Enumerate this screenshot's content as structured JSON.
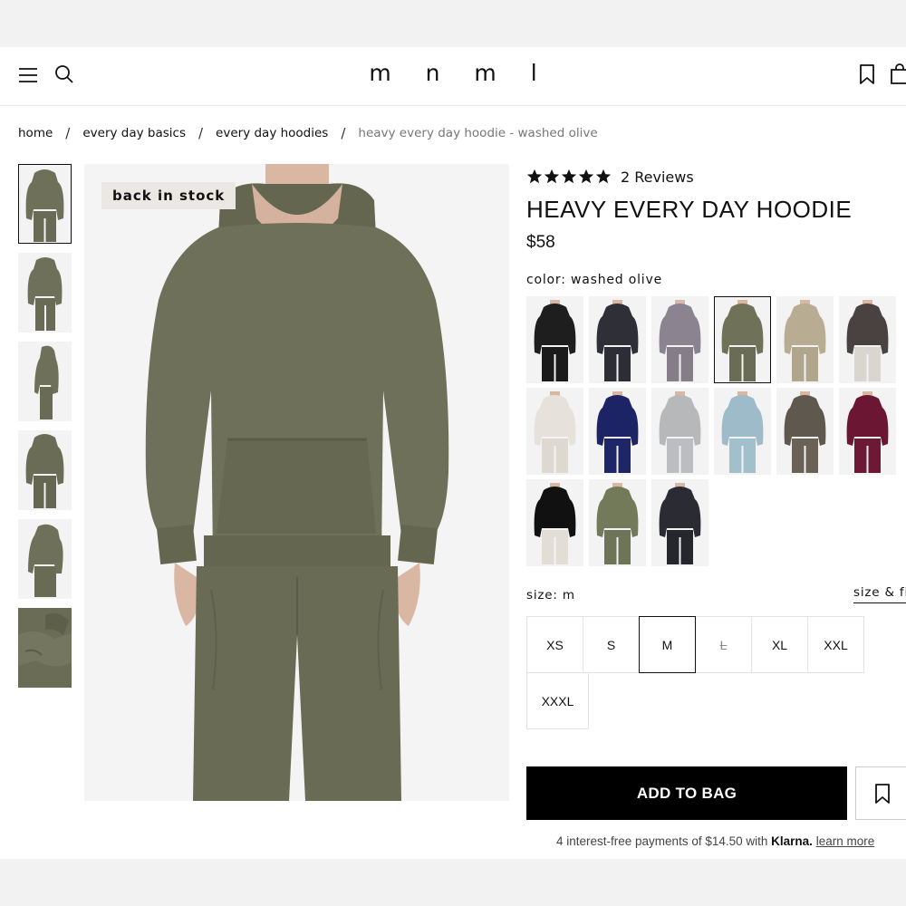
{
  "header": {
    "logo": "m n m l",
    "icons": [
      "menu-icon",
      "search-icon",
      "bookmark-icon",
      "bag-icon"
    ]
  },
  "breadcrumb": {
    "items": [
      "home",
      "every day basics",
      "every day hoodies"
    ],
    "separator": "/",
    "current": "heavy every day hoodie - washed olive"
  },
  "gallery": {
    "badge": "back in stock",
    "thumb_count": 6,
    "active_thumb": 0
  },
  "product": {
    "rating_stars": 5,
    "reviews": "2 Reviews",
    "title": "HEAVY EVERY DAY HOODIE",
    "price": "$58",
    "color_label": "color: washed olive",
    "colors": [
      {
        "hoodie": "#1e1e1f",
        "pant": "#1b1b1c"
      },
      {
        "hoodie": "#2f2f38",
        "pant": "#2d2d35"
      },
      {
        "hoodie": "#8b8490",
        "pant": "#857e88"
      },
      {
        "hoodie": "#6f7158",
        "pant": "#6a6c55"
      },
      {
        "hoodie": "#b8ad93",
        "pant": "#b0a68e"
      },
      {
        "hoodie": "#4a4240",
        "pant": "#d9d6d0"
      },
      {
        "hoodie": "#e6e2db",
        "pant": "#ddd8d0"
      },
      {
        "hoodie": "#1d2466",
        "pant": "#1f2668"
      },
      {
        "hoodie": "#b7b8ba",
        "pant": "#bcbdc0"
      },
      {
        "hoodie": "#9dbbc9",
        "pant": "#a2bfcc"
      },
      {
        "hoodie": "#5f584e",
        "pant": "#6a6257"
      },
      {
        "hoodie": "#6b1632",
        "pant": "#6d1835"
      },
      {
        "hoodie": "#111111",
        "pant": "#e2ded6"
      },
      {
        "hoodie": "#737a5a",
        "pant": "#6e7457"
      },
      {
        "hoodie": "#2b2b33",
        "pant": "#26262d"
      }
    ],
    "active_color": 3,
    "size_label": "size: m",
    "size_fit": "size & fit",
    "sizes": [
      "XS",
      "S",
      "M",
      "L",
      "XL",
      "XXL",
      "XXXL"
    ],
    "active_size": "M",
    "soldout_sizes": [
      "L"
    ],
    "add_to_bag": "ADD TO BAG",
    "klarna": {
      "prefix": "4 interest-free payments of $14.50 with",
      "brand": "Klarna.",
      "link": "learn more"
    }
  },
  "colors": {
    "olive_main": "#6f7059",
    "olive_dark": "#5e5f4a",
    "skin": "#d9b7a3",
    "black": "#000000"
  }
}
